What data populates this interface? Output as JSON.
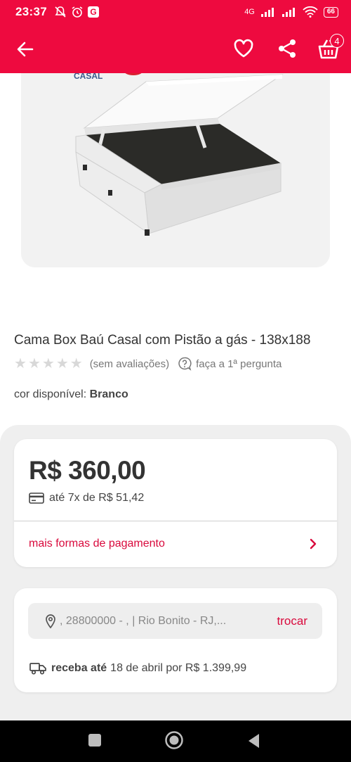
{
  "status_bar": {
    "time": "23:37",
    "network": "4G",
    "battery": "66"
  },
  "header": {
    "cart_count": "4"
  },
  "image": {
    "label": "CASAL"
  },
  "product": {
    "title": "Cama Box Baú Casal com Pistão a gás - 138x188",
    "rating_text": "(sem avaliações)",
    "question_text": "faça a 1ª pergunta",
    "color_label": "cor disponível:",
    "color_value": "Branco"
  },
  "pricing": {
    "price": "R$ 360,00",
    "installments": "até 7x de R$ 51,42",
    "more_payment": "mais formas de pagamento"
  },
  "shipping": {
    "address": ", 28800000 - ,  | Rio Bonito - RJ,...",
    "change_label": "trocar",
    "receive_label": "receba até",
    "receive_text": "18 de abril por R$ 1.399,99"
  },
  "colors": {
    "brand": "#ee0a3f",
    "link": "#d9093c"
  }
}
